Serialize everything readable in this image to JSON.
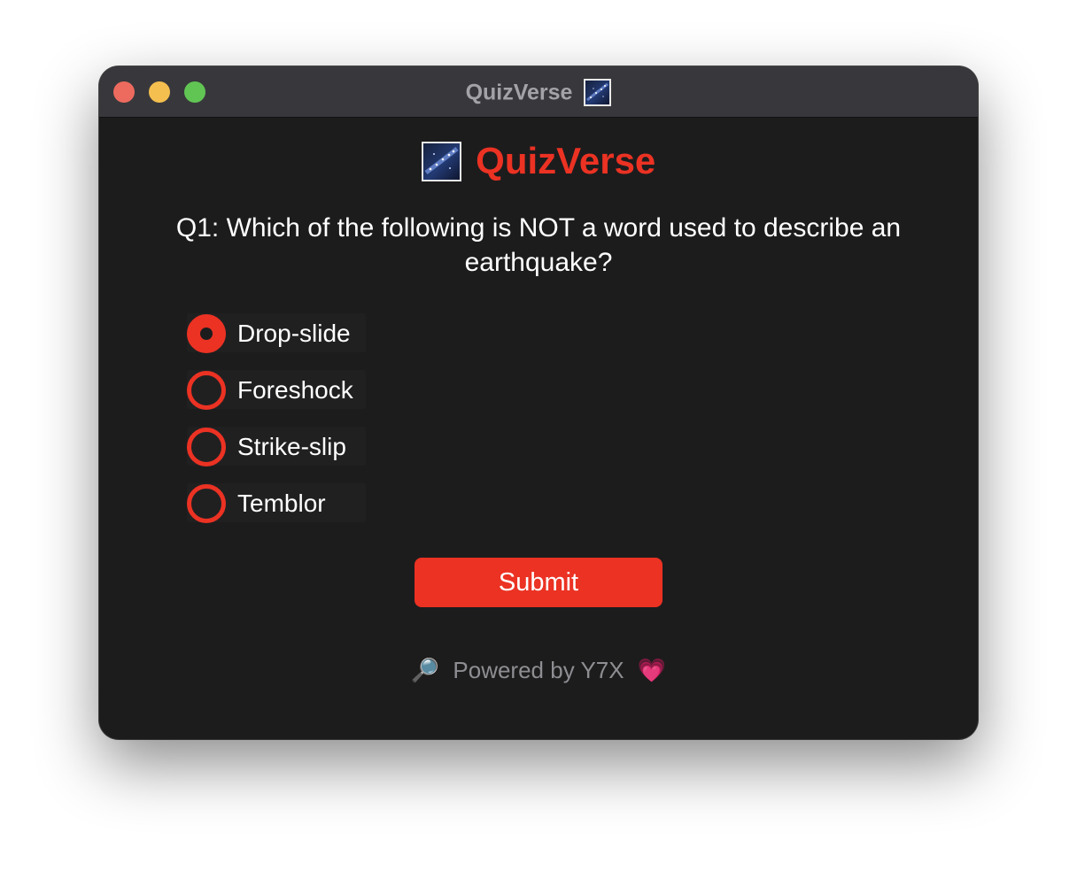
{
  "window": {
    "title": "QuizVerse",
    "title_icon": "milky-way-picture-icon"
  },
  "header": {
    "app_name": "QuizVerse",
    "icon": "milky-way-picture-icon"
  },
  "question": {
    "text": "Q1: Which of the following is NOT a word used to describe an earthquake?"
  },
  "options": [
    {
      "label": "Drop-slide",
      "selected": true
    },
    {
      "label": "Foreshock",
      "selected": false
    },
    {
      "label": "Strike-slip",
      "selected": false
    },
    {
      "label": "Temblor",
      "selected": false
    }
  ],
  "submit": {
    "label": "Submit"
  },
  "footer": {
    "magnifier": "🔎",
    "text": "Powered by Y7X",
    "heart": "💗"
  },
  "colors": {
    "accent": "#eb3223",
    "background": "#1c1c1d",
    "titlebar": "#38383c",
    "text": "#ffffff",
    "muted": "#8e8e92"
  }
}
